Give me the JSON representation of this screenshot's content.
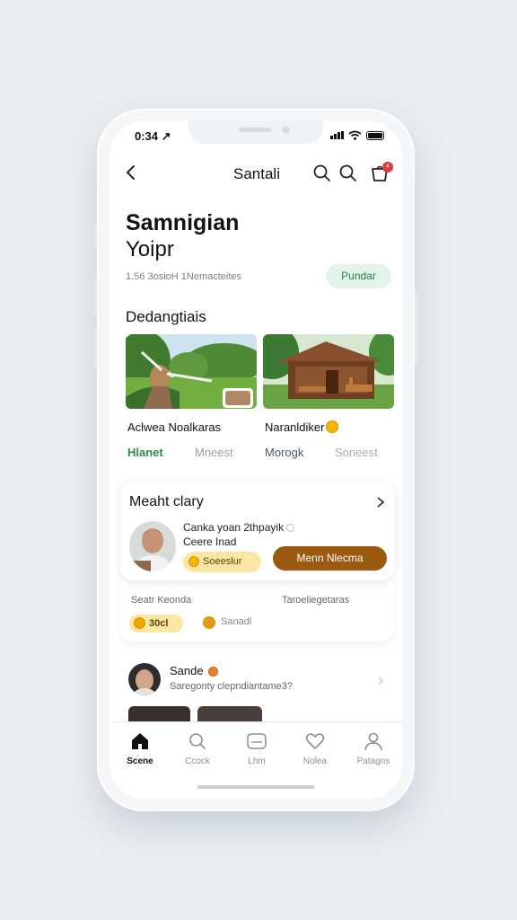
{
  "status_bar": {
    "time": "0:34 ↗"
  },
  "header": {
    "title": "Santali",
    "cart_count": "4"
  },
  "hero": {
    "title": "Samnigian",
    "subtitle": "Yoipr",
    "meta": "1.56 3osioH 1Nemacteites",
    "pill": "Pundar"
  },
  "destinations": {
    "section_title": "Dedangtiais",
    "cards": [
      {
        "name": "Aclwea Noalkaras",
        "tag": "Hlanet",
        "tag2": "Mneest"
      },
      {
        "name": "Naranldiker",
        "tag": "Morogk",
        "tag2": "Soneest"
      }
    ]
  },
  "panel": {
    "title": "Meaht clary",
    "person_name": "Canka yoan 2thpayik",
    "person_role": "Ceere Inad",
    "badge": "Soeeslur",
    "cta": "Menn Nlecma",
    "label_left": "Seatr Keonda",
    "label_right": "Taroeliegetaras",
    "chip_amount": "30cl",
    "chip_text": "Sanadl"
  },
  "feed": {
    "name": "Sande",
    "subtitle": "Saregonty clepndiantame3?"
  },
  "tabbar": {
    "tabs": [
      {
        "label": "Scene",
        "icon": "home-icon"
      },
      {
        "label": "Ccock",
        "icon": "search-icon"
      },
      {
        "label": "Lhm",
        "icon": "chat-icon"
      },
      {
        "label": "Nolea",
        "icon": "heart-icon"
      },
      {
        "label": "Patagns",
        "icon": "profile-icon"
      }
    ]
  },
  "colors": {
    "accent_green": "#2e7d4a",
    "cta_brown": "#9b5a0f",
    "coin_gold": "#f4b400",
    "badge_red": "#e53935"
  }
}
